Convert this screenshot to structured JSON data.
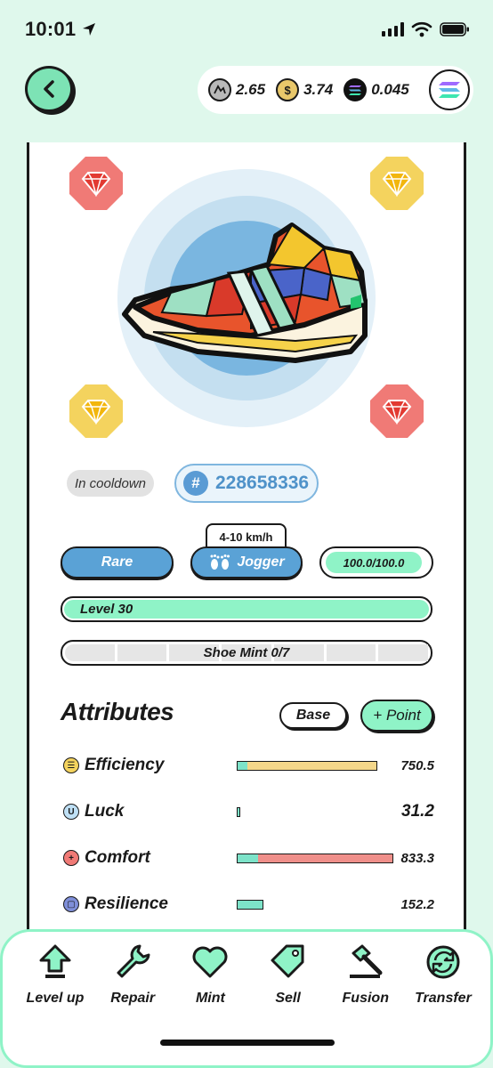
{
  "status_bar": {
    "time": "10:01"
  },
  "header": {
    "balances": [
      {
        "icon": "gst-token-icon",
        "value": "2.65",
        "color": "#b9b9b9"
      },
      {
        "icon": "gmt-token-icon",
        "value": "3.74",
        "color": "#e8c76a"
      },
      {
        "icon": "sol-token-icon",
        "value": "0.045",
        "color": "#111111"
      }
    ]
  },
  "shoe": {
    "status": "In cooldown",
    "id_prefix": "#",
    "id": "228658336",
    "speed_range": "4-10 km/h",
    "quality": "Rare",
    "type": "Jogger",
    "durability": "100.0/100.0",
    "level": "Level 30",
    "mint": "Shoe Mint 0/7",
    "mint_count": 0,
    "mint_max": 7,
    "sockets": [
      {
        "position": "top-left",
        "color": "red"
      },
      {
        "position": "top-right",
        "color": "yellow"
      },
      {
        "position": "bottom-left",
        "color": "yellow"
      },
      {
        "position": "bottom-right",
        "color": "red"
      }
    ]
  },
  "attributes": {
    "title": "Attributes",
    "base_label": "Base",
    "point_label": "+ Point",
    "items": [
      {
        "name": "Efficiency",
        "value": "750.5",
        "icon": "efficiency-icon",
        "icon_glyph": "☰",
        "icon_color": "#f4d35e",
        "bar_color": "#f4d78a",
        "base_fraction": 0.06,
        "fraction": 0.9
      },
      {
        "name": "Luck",
        "value": "31.2",
        "icon": "luck-icon",
        "icon_glyph": "U",
        "icon_color": "#bfe0f5",
        "bar_color": "#7de3c9",
        "base_fraction": 0.02,
        "fraction": 0.02
      },
      {
        "name": "Comfort",
        "value": "833.3",
        "icon": "comfort-icon",
        "icon_glyph": "+",
        "icon_color": "#f07a76",
        "bar_color": "#ef8f8a",
        "base_fraction": 0.13,
        "fraction": 1.0
      },
      {
        "name": "Resilience",
        "value": "152.2",
        "icon": "resilience-icon",
        "icon_glyph": "▢",
        "icon_color": "#7f8fd9",
        "bar_color": "#7de3c9",
        "base_fraction": 0.17,
        "fraction": 0.17
      }
    ]
  },
  "actions": [
    {
      "label": "Level up",
      "icon": "level-up-icon"
    },
    {
      "label": "Repair",
      "icon": "wrench-icon"
    },
    {
      "label": "Mint",
      "icon": "heart-icon"
    },
    {
      "label": "Sell",
      "icon": "tag-icon"
    },
    {
      "label": "Fusion",
      "icon": "hammer-icon"
    },
    {
      "label": "Transfer",
      "icon": "transfer-icon"
    }
  ]
}
